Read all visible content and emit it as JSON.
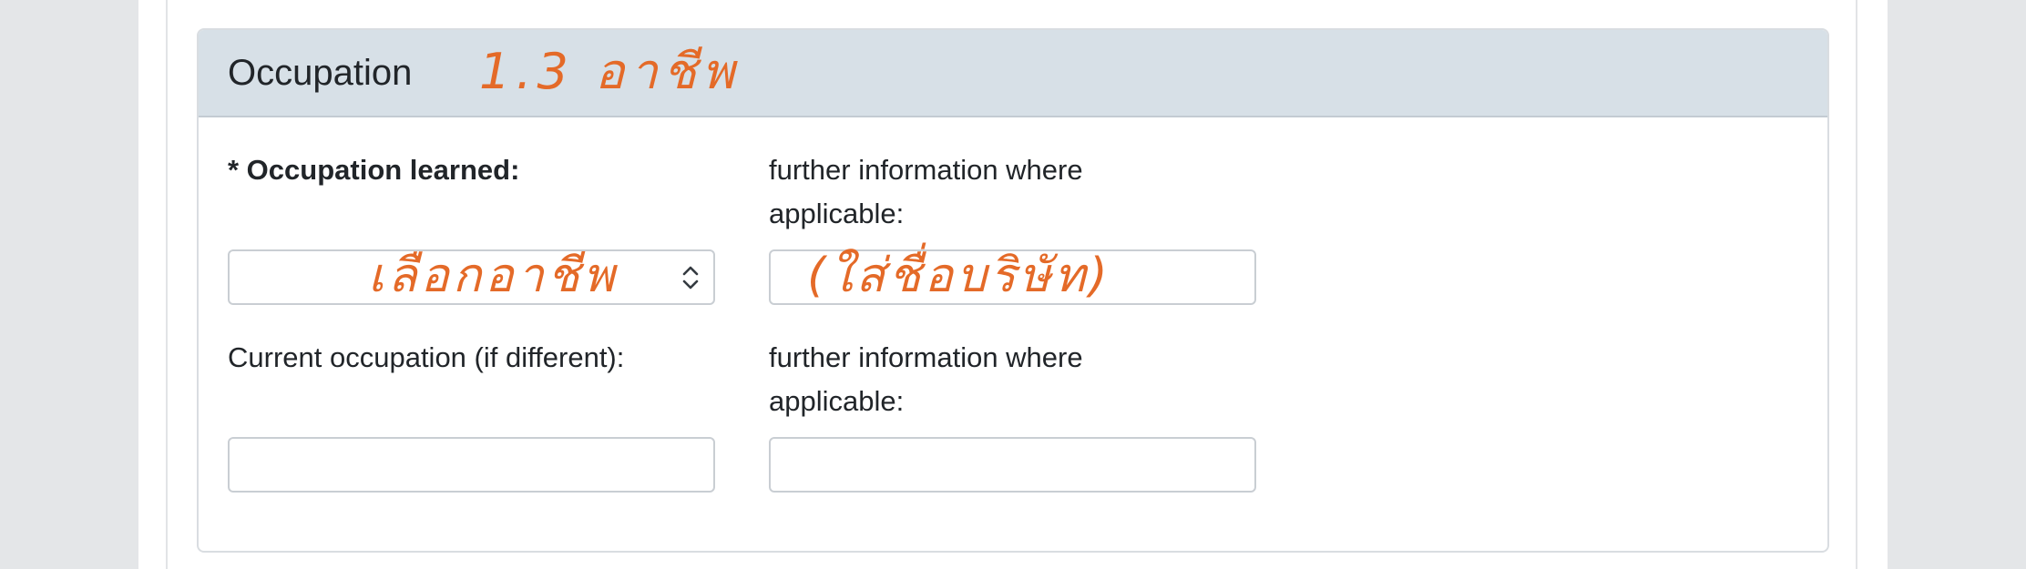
{
  "section": {
    "title": "Occupation",
    "handwritten_note": "1.3  อาชีพ"
  },
  "fields": {
    "occupation_learned": {
      "label": "* Occupation learned:",
      "selected_value": "",
      "handwritten_note": "เลือกอาชีพ"
    },
    "occupation_learned_info": {
      "label": "further information where applicable:",
      "value": "",
      "handwritten_note": "(ใส่ชื่อบริษัท)"
    },
    "current_occupation": {
      "label": "Current occupation (if different):",
      "value": ""
    },
    "current_occupation_info": {
      "label": "further information where applicable:",
      "value": ""
    }
  },
  "colors": {
    "annotation": "#e46a28",
    "panel_header": "#d7e0e7"
  },
  "icons": {
    "select_chevron": "chevron-up-down-icon"
  }
}
